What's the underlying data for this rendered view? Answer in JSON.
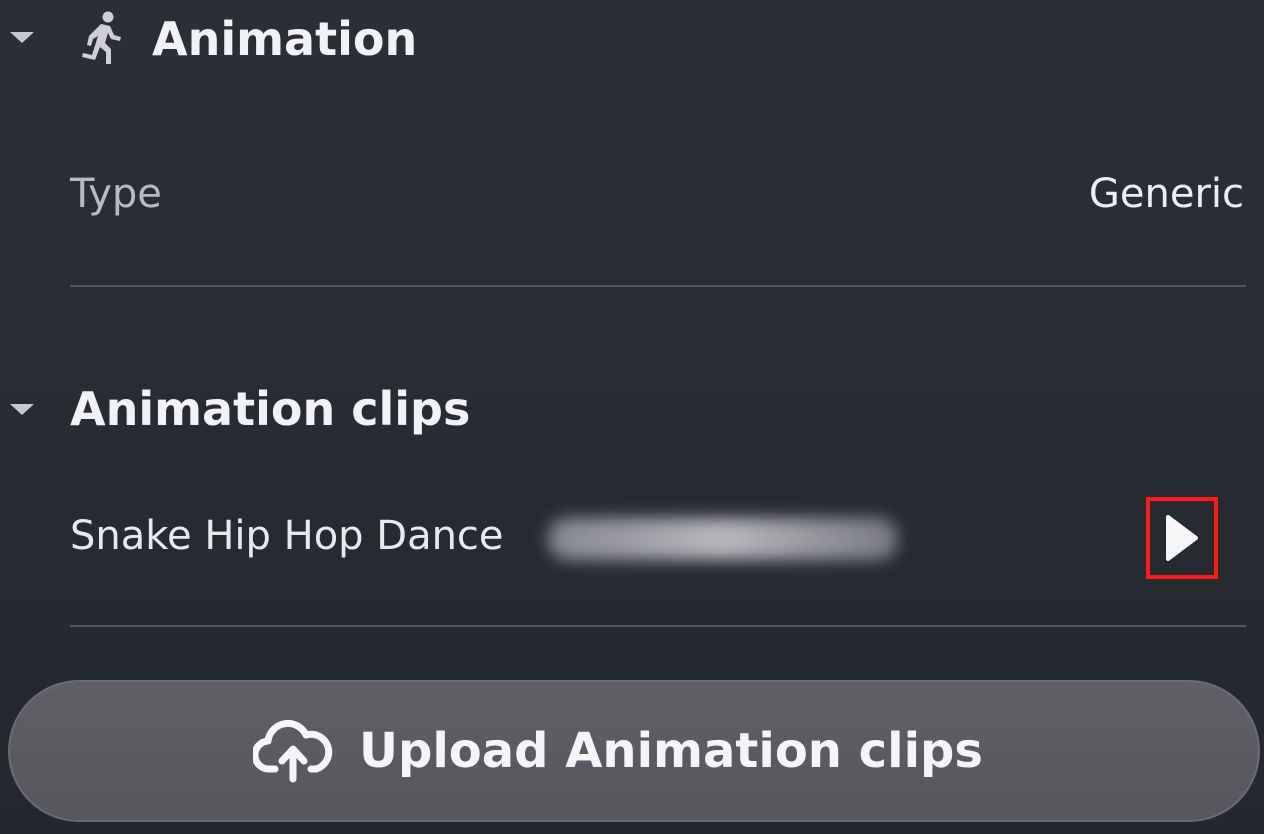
{
  "animation_section": {
    "title": "Animation",
    "icon": "running-person-icon",
    "type_label": "Type",
    "type_value": "Generic"
  },
  "clips_section": {
    "title": "Animation clips",
    "clips": [
      {
        "name": "Snake Hip Hop Dance",
        "play_icon": "play-icon"
      }
    ]
  },
  "upload_button": {
    "label": "Upload Animation clips",
    "icon": "cloud-upload-icon"
  },
  "colors": {
    "background": "#2a2c34",
    "highlight_border": "#ff1a1a",
    "button_bg": "#5a5c62"
  }
}
